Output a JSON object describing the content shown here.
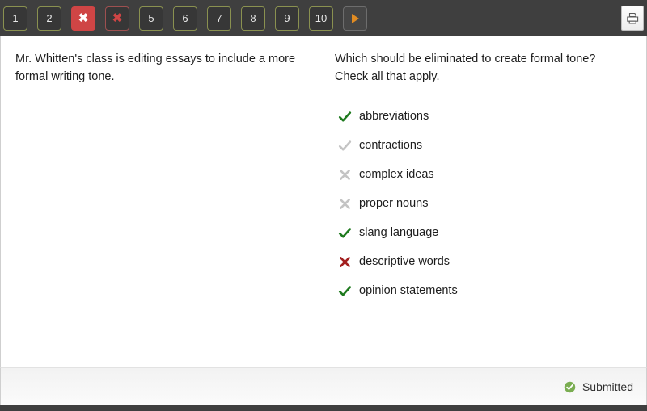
{
  "topbar": {
    "question_buttons": [
      {
        "label": "1",
        "state": "unanswered",
        "icon": "none"
      },
      {
        "label": "2",
        "state": "unanswered",
        "icon": "none"
      },
      {
        "label": "",
        "state": "wrong-current",
        "icon": "x-icon"
      },
      {
        "label": "",
        "state": "wrong",
        "icon": "x-icon"
      },
      {
        "label": "5",
        "state": "unanswered",
        "icon": "none"
      },
      {
        "label": "6",
        "state": "unanswered",
        "icon": "none"
      },
      {
        "label": "7",
        "state": "unanswered",
        "icon": "none"
      },
      {
        "label": "8",
        "state": "unanswered",
        "icon": "none"
      },
      {
        "label": "9",
        "state": "unanswered",
        "icon": "none"
      },
      {
        "label": "10",
        "state": "unanswered",
        "icon": "none"
      }
    ],
    "next_button": {
      "label": "",
      "icon": "triangle-right-icon"
    },
    "print_button": {
      "icon": "printer-icon"
    },
    "colors": {
      "bar_background": "#3f3f3f",
      "button_border": "#8a9150",
      "wrong_current_background": "#cf4545",
      "wrong_border": "#9e5050",
      "next_arrow": "#e08b22"
    }
  },
  "main": {
    "passage": "Mr. Whitten's class is editing essays to include a more formal writing tone.",
    "question": "Which should be eliminated to create formal tone? Check all that apply.",
    "options": [
      {
        "label": "abbreviations",
        "icon": "check-icon",
        "mark": "correct-selected",
        "color": "#1e7a1e"
      },
      {
        "label": "contractions",
        "icon": "check-icon",
        "mark": "correct-unselected",
        "color": "#c4c4c4"
      },
      {
        "label": "complex ideas",
        "icon": "x-icon",
        "mark": "incorrect-unselected",
        "color": "#c4c4c4"
      },
      {
        "label": "proper nouns",
        "icon": "x-icon",
        "mark": "incorrect-unselected",
        "color": "#c4c4c4"
      },
      {
        "label": "slang language",
        "icon": "check-icon",
        "mark": "correct-selected",
        "color": "#1e7a1e"
      },
      {
        "label": "descriptive words",
        "icon": "x-icon",
        "mark": "incorrect-selected",
        "color": "#a32020"
      },
      {
        "label": "opinion statements",
        "icon": "check-icon",
        "mark": "correct-selected",
        "color": "#1e7a1e"
      }
    ]
  },
  "footer": {
    "status_label": "Submitted",
    "status_icon": "circle-check-icon",
    "status_color": "#7aad51"
  }
}
